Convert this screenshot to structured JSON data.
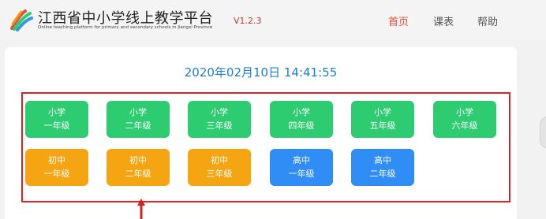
{
  "header": {
    "title": "江西省中小学线上教学平台",
    "subtitle": "Online teaching platform for primary and secondary schools in Jiangxi Province",
    "version": "V1.2.3",
    "logo_icon": "colorful-flag-logo-icon"
  },
  "nav": {
    "items": [
      {
        "label": "首页",
        "active": true
      },
      {
        "label": "课表",
        "active": false
      },
      {
        "label": "帮助",
        "active": false
      }
    ]
  },
  "main": {
    "datetime": "2020年02月10日 14:41:55",
    "grades": [
      {
        "level": "小学",
        "grade": "一年级",
        "color": "#2ecc71"
      },
      {
        "level": "小学",
        "grade": "二年级",
        "color": "#2ecc71"
      },
      {
        "level": "小学",
        "grade": "三年级",
        "color": "#2ecc71"
      },
      {
        "level": "小学",
        "grade": "四年级",
        "color": "#2ecc71"
      },
      {
        "level": "小学",
        "grade": "五年级",
        "color": "#2ecc71"
      },
      {
        "level": "小学",
        "grade": "六年级",
        "color": "#2ecc71"
      },
      {
        "level": "初中",
        "grade": "一年级",
        "color": "#f5a511"
      },
      {
        "level": "初中",
        "grade": "二年级",
        "color": "#f5a511"
      },
      {
        "level": "初中",
        "grade": "三年级",
        "color": "#f5a511"
      },
      {
        "level": "高中",
        "grade": "一年级",
        "color": "#2f8df5"
      },
      {
        "level": "高中",
        "grade": "二年级",
        "color": "#2f8df5"
      }
    ]
  },
  "annotations": {
    "highlight_color": "#e22222",
    "arrow_icon": "red-arrow-up-icon"
  }
}
